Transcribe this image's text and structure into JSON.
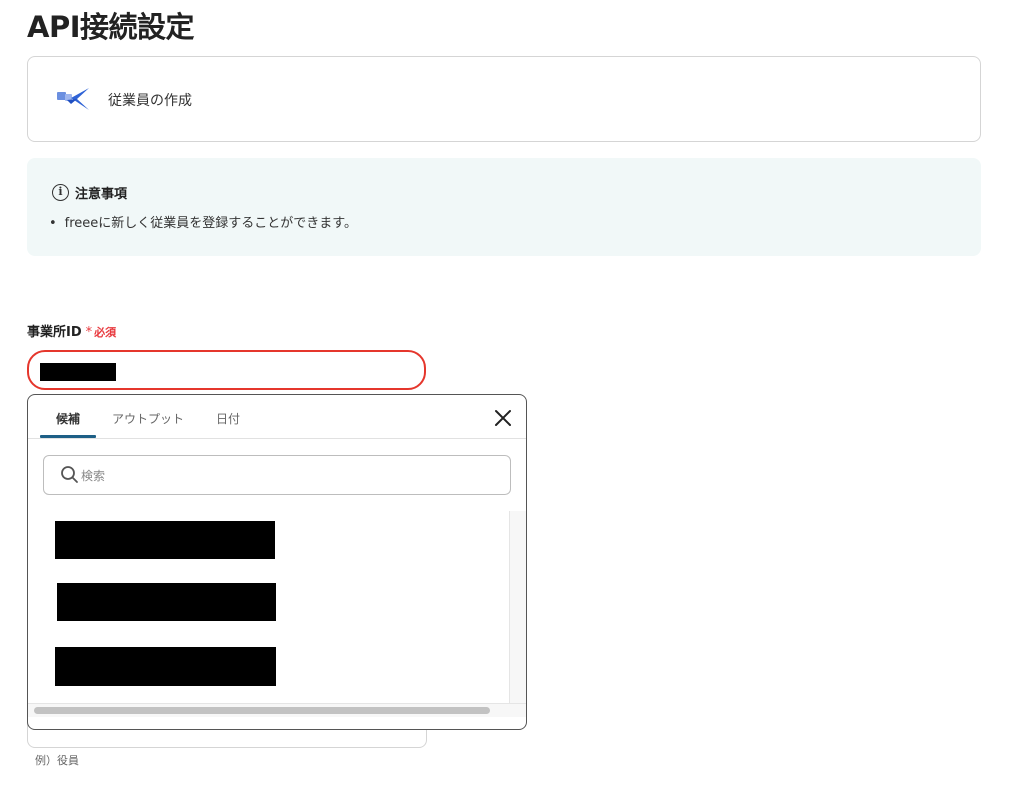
{
  "page": {
    "title": "API接続設定"
  },
  "action": {
    "label": "従業員の作成",
    "icon": "freee-bird-icon"
  },
  "notice": {
    "title": "注意事項",
    "icon": "info-icon",
    "items": [
      "freeeに新しく従業員を登録することができます。"
    ],
    "background": "#f1f8f8"
  },
  "field": {
    "label": "事業所ID",
    "required_mark": "*",
    "required_text": "必須",
    "value": "",
    "highlight_color": "#e5362c"
  },
  "popover": {
    "tabs": [
      {
        "label": "候補",
        "active": true
      },
      {
        "label": "アウトプット",
        "active": false
      },
      {
        "label": "日付",
        "active": false
      }
    ],
    "close_icon": "close-icon",
    "search_placeholder": "検索",
    "accent_color": "#1d5f86",
    "candidates": [
      {
        "label": "",
        "redacted": true
      },
      {
        "label": "",
        "redacted": true
      },
      {
        "label": "",
        "redacted": true
      }
    ]
  },
  "secondary_field": {
    "example": "例）役員"
  }
}
